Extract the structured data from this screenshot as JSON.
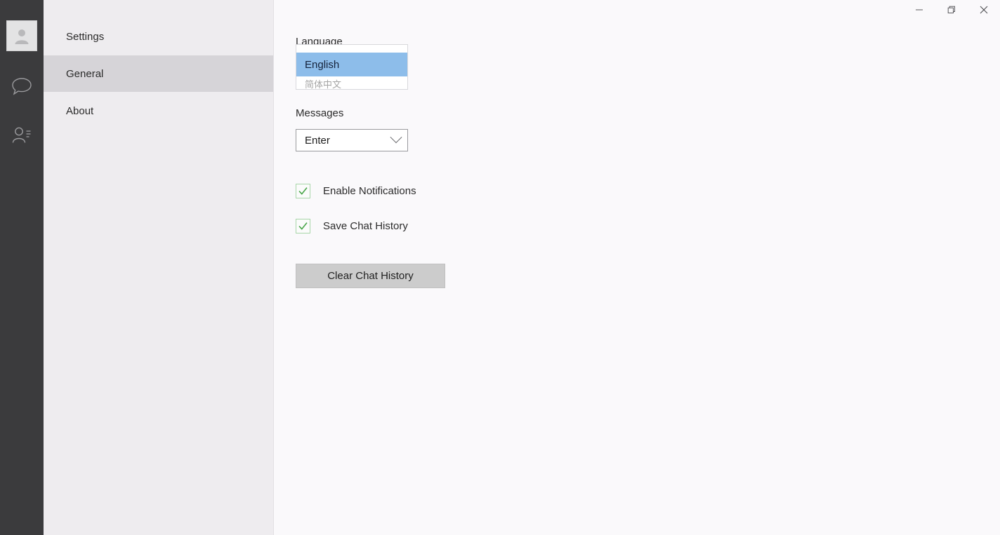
{
  "window": {
    "controls": [
      {
        "name": "minimize",
        "icon": "minimize-icon",
        "label": "Minimize"
      },
      {
        "name": "restore",
        "icon": "restore-icon",
        "label": "Restore"
      },
      {
        "name": "close",
        "icon": "close-icon",
        "label": "Close"
      }
    ]
  },
  "rail": {
    "items": [
      {
        "icon": "user-avatar-icon",
        "label": "Profile",
        "active": true
      },
      {
        "icon": "chat-bubble-icon",
        "label": "Chats",
        "active": false
      },
      {
        "icon": "contacts-icon",
        "label": "Contacts",
        "active": false
      }
    ]
  },
  "nav": {
    "items": [
      {
        "label": "Settings",
        "selected": false
      },
      {
        "label": "General",
        "selected": true
      },
      {
        "label": "About",
        "selected": false
      }
    ]
  },
  "content": {
    "language": {
      "label": "Language",
      "value": "English",
      "open": true,
      "options": [
        {
          "label": "English",
          "selected": true,
          "clipped": false
        },
        {
          "label": "简体中文",
          "selected": false,
          "clipped": true
        }
      ]
    },
    "messages": {
      "label": "Messages",
      "value": "Enter",
      "open": false
    },
    "checkboxes": [
      {
        "label": "Enable Notifications",
        "checked": true
      },
      {
        "label": "Save Chat History",
        "checked": true
      }
    ],
    "clear_button": {
      "label": "Clear Chat History"
    }
  },
  "colors": {
    "rail_bg": "#3b3b3d",
    "nav_bg": "#eeecef",
    "nav_selected": "#d6d4d8",
    "content_bg": "#faf9fb",
    "dropdown_highlight": "#8dbdea",
    "checkbox_check": "#4aa64a",
    "button_bg": "#cccccc"
  }
}
